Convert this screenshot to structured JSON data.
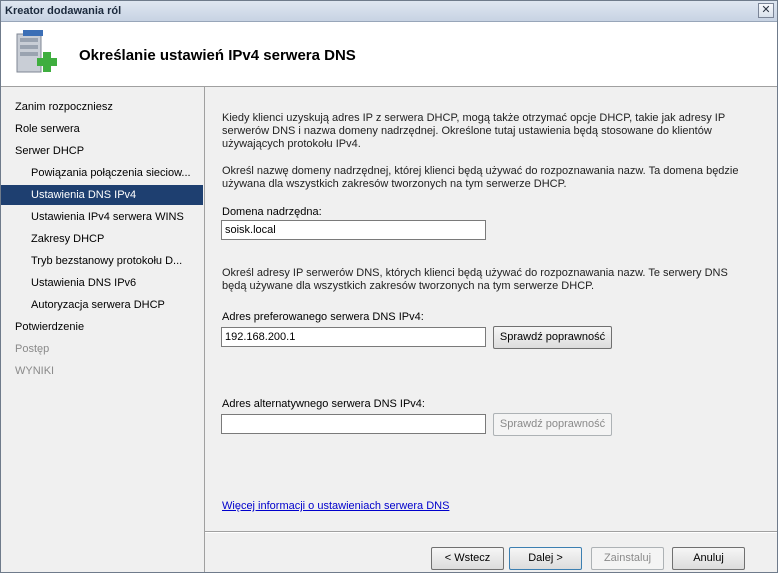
{
  "window": {
    "title": "Kreator dodawania ról",
    "close_glyph": "✕"
  },
  "header": {
    "title": "Określanie ustawień IPv4 serwera DNS",
    "icon": "server-add-icon"
  },
  "sidebar": {
    "items": [
      {
        "label": "Zanim rozpoczniesz",
        "level": 0,
        "state": "normal"
      },
      {
        "label": "Role serwera",
        "level": 0,
        "state": "normal"
      },
      {
        "label": "Serwer DHCP",
        "level": 0,
        "state": "normal"
      },
      {
        "label": "Powiązania połączenia sieciow...",
        "level": 1,
        "state": "normal"
      },
      {
        "label": "Ustawienia DNS IPv4",
        "level": 1,
        "state": "active"
      },
      {
        "label": "Ustawienia IPv4 serwera WINS",
        "level": 1,
        "state": "normal"
      },
      {
        "label": "Zakresy DHCP",
        "level": 1,
        "state": "normal"
      },
      {
        "label": "Tryb bezstanowy protokołu D...",
        "level": 1,
        "state": "normal"
      },
      {
        "label": "Ustawienia DNS IPv6",
        "level": 1,
        "state": "normal"
      },
      {
        "label": "Autoryzacja serwera DHCP",
        "level": 1,
        "state": "normal"
      },
      {
        "label": "Potwierdzenie",
        "level": 0,
        "state": "normal"
      },
      {
        "label": "Postęp",
        "level": 0,
        "state": "disabled"
      },
      {
        "label": "WYNIKI",
        "level": 0,
        "state": "disabled"
      }
    ]
  },
  "main": {
    "intro": "Kiedy klienci uzyskują adres IP z serwera DHCP, mogą także otrzymać opcje DHCP, takie jak adresy IP serwerów DNS i nazwa domeny nadrzędnej. Określone tutaj ustawienia będą stosowane do klientów używających protokołu IPv4.",
    "domain_desc": "Określ nazwę domeny nadrzędnej, której klienci będą używać do rozpoznawania nazw. Ta domena będzie używana dla wszystkich zakresów tworzonych na tym serwerze DHCP.",
    "domain_label": "Domena nadrzędna:",
    "domain_value": "soisk.local",
    "dns_desc": "Określ adresy IP serwerów DNS, których klienci będą używać do rozpoznawania nazw. Te serwery DNS będą używane dla wszystkich zakresów tworzonych na tym serwerze DHCP.",
    "preferred_label": "Adres preferowanego serwera DNS IPv4:",
    "preferred_value": "192.168.200.1",
    "verify_label": "Sprawdź poprawność",
    "alternate_label": "Adres alternatywnego serwera DNS IPv4:",
    "alternate_value": "",
    "verify_alt_label": "Sprawdź poprawność",
    "more_info_link": "Więcej informacji o ustawieniach serwera DNS"
  },
  "footer": {
    "back": "< Wstecz",
    "next": "Dalej >",
    "install": "Zainstaluj",
    "cancel": "Anuluj"
  },
  "colors": {
    "selection": "#1e3f70",
    "link": "#0000cc"
  }
}
